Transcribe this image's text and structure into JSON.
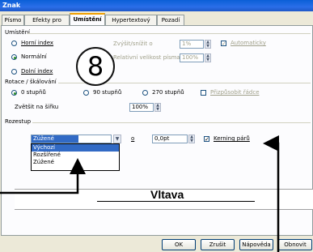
{
  "window": {
    "title": "Znak"
  },
  "tabs": [
    {
      "label": "Písmo",
      "active": false
    },
    {
      "label": "Efekty pro písmo",
      "active": false
    },
    {
      "label": "Umístění",
      "active": true
    },
    {
      "label": "Hypertextový odkaz",
      "active": false
    },
    {
      "label": "Pozadí",
      "active": false
    }
  ],
  "position": {
    "group_label": "Umístění",
    "superscript_label": "Horní index",
    "normal_label": "Normální",
    "subscript_label": "Dolní index",
    "raise_label": "Zvýšit/snížit o",
    "raise_value": "1%",
    "rel_size_label": "Relativní velikost písma",
    "rel_size_value": "100%",
    "auto_label": "Automaticky",
    "selected": "normal"
  },
  "rotation": {
    "group_label": "Rotace / škálování",
    "deg0_label": "0 stupňů",
    "deg90_label": "90 stupňů",
    "deg270_label": "270 stupňů",
    "fit_label": "Přizpůsobit řádce",
    "scale_label": "Zvětšit na šířku",
    "scale_value": "100%",
    "selected": "0"
  },
  "spacing": {
    "group_label": "Rozestup",
    "combo_value": "Zúžené",
    "by_label": "o",
    "by_value": "0,0pt",
    "kerning_label": "Kerning párů",
    "kerning_checked": true,
    "dropdown_options": [
      "Výchozí",
      "Rozšířené",
      "Zúžené"
    ],
    "dropdown_selected_index": 0
  },
  "preview": {
    "text": "Vltava"
  },
  "callout": {
    "number": "8"
  },
  "buttons": {
    "ok": "OK",
    "cancel": "Zrušit",
    "help": "Nápověda",
    "reset": "Obnovit"
  },
  "glyphs": {
    "check": "✓",
    "spin_up": "▲",
    "spin_down": "▼",
    "dropdown": "▼"
  },
  "colors": {
    "titlebar": "#0a5fd7",
    "selection": "#316ac5",
    "active_tab_accent": "#f0a000"
  }
}
